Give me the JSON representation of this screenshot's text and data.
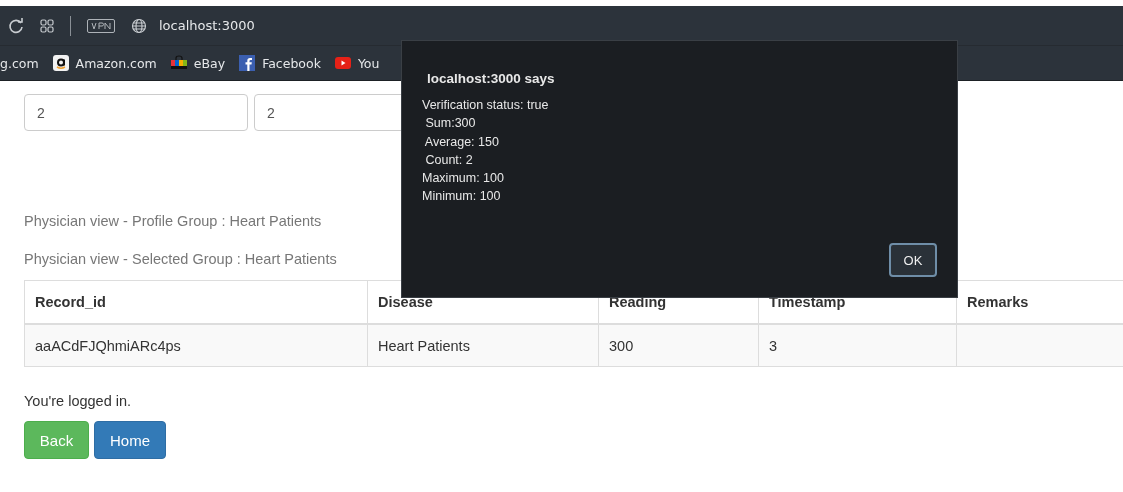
{
  "browser": {
    "address": "localhost:3000",
    "bookmarks": [
      {
        "kind": "plain",
        "label": "g.com"
      },
      {
        "kind": "amazon",
        "label": "Amazon.com"
      },
      {
        "kind": "ebay",
        "label": "eBay"
      },
      {
        "kind": "facebook",
        "label": "Facebook"
      },
      {
        "kind": "youtube",
        "label": "You"
      }
    ]
  },
  "inputs": [
    {
      "value": "2"
    },
    {
      "value": "2"
    }
  ],
  "group_lines": [
    "Physician view - Profile Group : Heart Patients",
    "Physician view - Selected Group : Heart Patients"
  ],
  "table": {
    "columns": [
      "Record_id",
      "Disease",
      "Reading",
      "Timestamp",
      "Remarks"
    ],
    "rows": [
      [
        "aaACdFJQhmiARc4ps",
        "Heart Patients",
        "300",
        "3",
        ""
      ]
    ]
  },
  "status_text": "You're logged in.",
  "buttons": [
    {
      "kind": "success",
      "label": "Back"
    },
    {
      "kind": "primary",
      "label": "Home"
    }
  ],
  "dialog": {
    "title": "localhost:3000 says",
    "lines": [
      "Verification status: true",
      " Sum:300",
      " Average: 150",
      " Count: 2",
      "Maximum: 100",
      "Minimum: 100"
    ],
    "button": "OK"
  }
}
